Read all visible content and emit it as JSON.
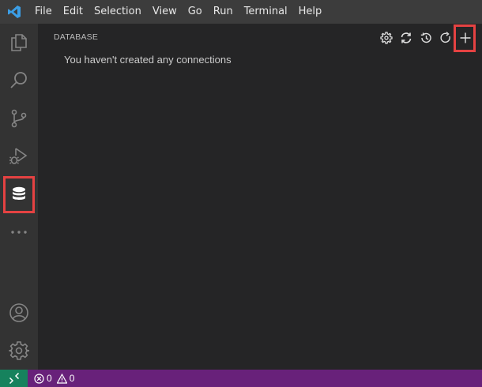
{
  "menu": {
    "items": [
      "File",
      "Edit",
      "Selection",
      "View",
      "Go",
      "Run",
      "Terminal",
      "Help"
    ]
  },
  "activity_bar": {
    "icons": [
      "explorer-icon",
      "search-icon",
      "source-control-icon",
      "run-debug-icon",
      "database-icon",
      "more-icon",
      "account-icon",
      "settings-gear-icon"
    ],
    "active": "database-icon"
  },
  "sidebar": {
    "title": "DATABASE",
    "empty_message": "You haven't created any connections",
    "actions": [
      "settings-icon",
      "sync-icon",
      "history-icon",
      "refresh-icon",
      "add-icon"
    ]
  },
  "status_bar": {
    "errors": "0",
    "warnings": "0"
  },
  "colors": {
    "status_bar": "#68217a",
    "remote_indicator": "#16825d",
    "highlight": "#e54242",
    "title_bar": "#3c3c3c",
    "activity_bar": "#333333",
    "sidebar": "#252526"
  }
}
